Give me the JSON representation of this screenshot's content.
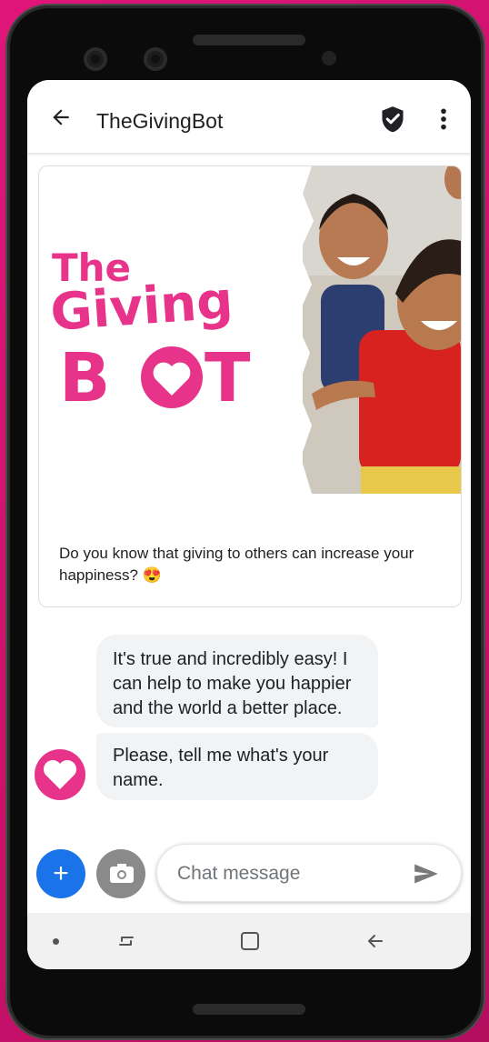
{
  "header": {
    "title": "TheGivingBot",
    "back_icon": "arrow-left-icon",
    "verified_icon": "shield-check-icon",
    "more_icon": "more-vert-icon"
  },
  "card": {
    "logo_lines": [
      "The",
      "Giving",
      "BOT"
    ],
    "text": "Do you know that giving to others can increase your happiness? 😍"
  },
  "messages": [
    {
      "text": "It's true and incredibly easy! I can help to make you happier and the world a better place."
    },
    {
      "text": "Please, tell me what's your name."
    }
  ],
  "composer": {
    "add_label": "+",
    "placeholder": "Chat message"
  },
  "colors": {
    "brand": "#e8338b",
    "accent": "#1a73e8",
    "background": "#d4126f"
  }
}
